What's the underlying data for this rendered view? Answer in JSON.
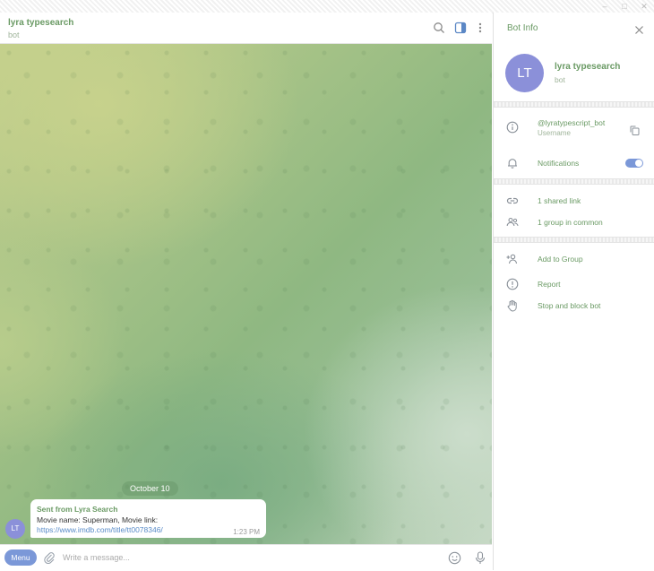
{
  "window": {
    "min_glyph": "–",
    "max_glyph": "□",
    "close_glyph": "✕"
  },
  "chat": {
    "title": "lyra typesearch",
    "subtitle": "bot",
    "header_icons": [
      "search-icon",
      "sidebar-toggle-icon",
      "more-icon"
    ]
  },
  "messages": {
    "date_separator": "October 10",
    "avatar_initials": "LT",
    "items": [
      {
        "sender": "Sent from Lyra Search",
        "text": "Movie name: Superman, Movie link:",
        "link": "https://www.imdb.com/title/tt0078346/",
        "time": "1:23 PM"
      }
    ]
  },
  "input": {
    "menu_label": "Menu",
    "placeholder": "Write a message...",
    "value": ""
  },
  "panel": {
    "title": "Bot Info",
    "profile": {
      "initials": "LT",
      "name": "lyra typesearch",
      "subtitle": "bot"
    },
    "username": {
      "value": "@lyratypescript_bot",
      "label": "Username"
    },
    "notifications": {
      "label": "Notifications",
      "enabled": true
    },
    "shared_links": "1 shared link",
    "groups_common": "1 group in common",
    "actions": {
      "add_to_group": "Add to Group",
      "report": "Report",
      "stop_block": "Stop and block bot"
    }
  },
  "colors": {
    "accent_green": "#6a9a64",
    "avatar": "#8b90d9",
    "link": "#5a8cc8",
    "button_blue": "#7b98d8"
  }
}
